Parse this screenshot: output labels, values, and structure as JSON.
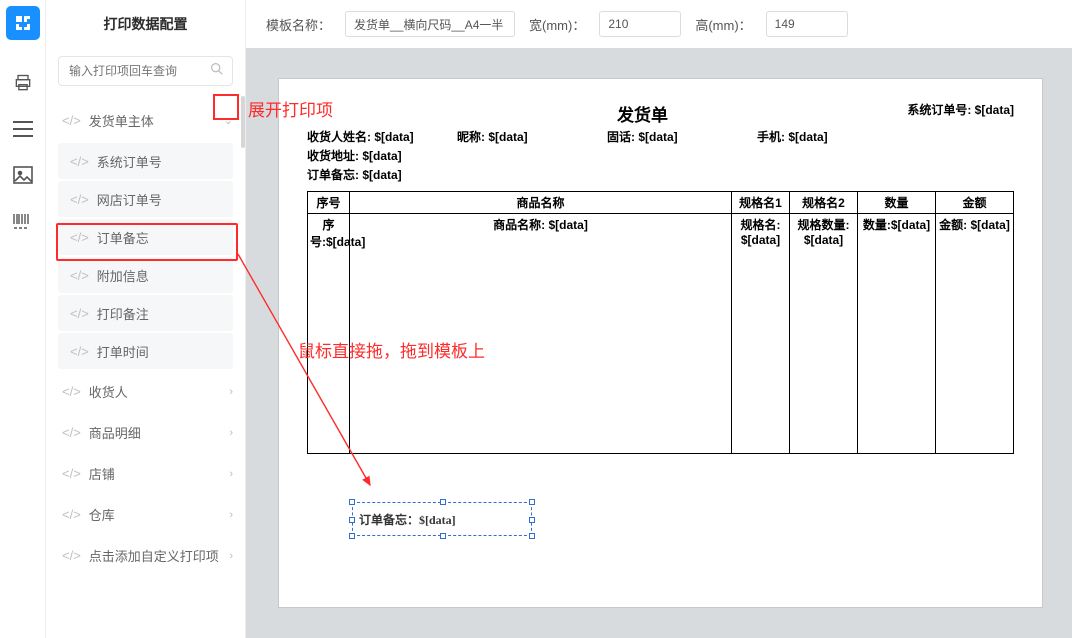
{
  "sidebar": {
    "title": "打印数据配置",
    "searchPlaceholder": "输入打印项回车查询",
    "nodes": [
      {
        "label": "发货单主体",
        "type": "parent",
        "expand": true
      },
      {
        "label": "系统订单号",
        "type": "child"
      },
      {
        "label": "网店订单号",
        "type": "child"
      },
      {
        "label": "订单备忘",
        "type": "child"
      },
      {
        "label": "附加信息",
        "type": "child"
      },
      {
        "label": "打印备注",
        "type": "child"
      },
      {
        "label": "打单时间",
        "type": "child"
      },
      {
        "label": "收货人",
        "type": "parent"
      },
      {
        "label": "商品明细",
        "type": "parent"
      },
      {
        "label": "店铺",
        "type": "parent"
      },
      {
        "label": "仓库",
        "type": "parent"
      },
      {
        "label": "点击添加自定义打印项",
        "type": "parent"
      }
    ]
  },
  "topbar": {
    "tplLabel": "模板名称：",
    "tplValue": "发货单__横向尺码__A4一半",
    "wLabel": "宽(mm)：",
    "wValue": "210",
    "hLabel": "高(mm)：",
    "hValue": "149"
  },
  "paper": {
    "title": "发货单",
    "sysOrder": "系统订单号: $[data]",
    "recvName": "收货人姓名: $[data]",
    "nick": "昵称: $[data]",
    "tel": "固话: $[data]",
    "mobile": "手机: $[data]",
    "addr": "收货地址: $[data]",
    "memo": "订单备忘: $[data]",
    "cols": [
      "序号",
      "商品名称",
      "规格名1",
      "规格名2",
      "数量",
      "金额"
    ],
    "rowVals": [
      "序号:$[data]",
      "商品名称: $[data]",
      "规格名: $[data]",
      "规格数量: $[data]",
      "数量:$[data]",
      "金额: $[data]"
    ],
    "dragged": "订单备忘：$[data]"
  },
  "annos": {
    "a1": "展开打印项",
    "a2": "鼠标直接拖，拖到模板上"
  }
}
